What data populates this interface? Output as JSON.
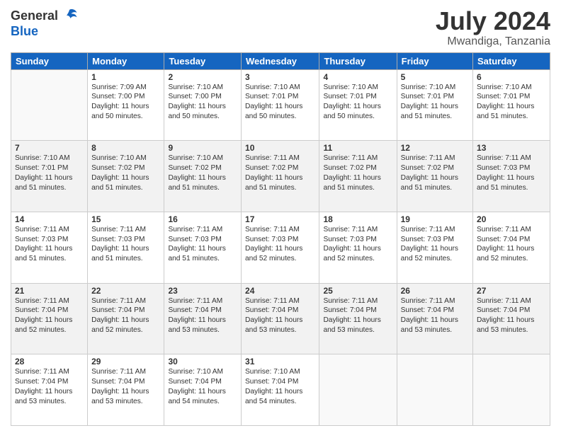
{
  "header": {
    "logo_general": "General",
    "logo_blue": "Blue",
    "month": "July 2024",
    "location": "Mwandiga, Tanzania"
  },
  "days_of_week": [
    "Sunday",
    "Monday",
    "Tuesday",
    "Wednesday",
    "Thursday",
    "Friday",
    "Saturday"
  ],
  "weeks": [
    [
      {
        "day": "",
        "info": ""
      },
      {
        "day": "1",
        "info": "Sunrise: 7:09 AM\nSunset: 7:00 PM\nDaylight: 11 hours\nand 50 minutes."
      },
      {
        "day": "2",
        "info": "Sunrise: 7:10 AM\nSunset: 7:00 PM\nDaylight: 11 hours\nand 50 minutes."
      },
      {
        "day": "3",
        "info": "Sunrise: 7:10 AM\nSunset: 7:01 PM\nDaylight: 11 hours\nand 50 minutes."
      },
      {
        "day": "4",
        "info": "Sunrise: 7:10 AM\nSunset: 7:01 PM\nDaylight: 11 hours\nand 50 minutes."
      },
      {
        "day": "5",
        "info": "Sunrise: 7:10 AM\nSunset: 7:01 PM\nDaylight: 11 hours\nand 51 minutes."
      },
      {
        "day": "6",
        "info": "Sunrise: 7:10 AM\nSunset: 7:01 PM\nDaylight: 11 hours\nand 51 minutes."
      }
    ],
    [
      {
        "day": "7",
        "info": "Sunrise: 7:10 AM\nSunset: 7:01 PM\nDaylight: 11 hours\nand 51 minutes."
      },
      {
        "day": "8",
        "info": "Sunrise: 7:10 AM\nSunset: 7:02 PM\nDaylight: 11 hours\nand 51 minutes."
      },
      {
        "day": "9",
        "info": "Sunrise: 7:10 AM\nSunset: 7:02 PM\nDaylight: 11 hours\nand 51 minutes."
      },
      {
        "day": "10",
        "info": "Sunrise: 7:11 AM\nSunset: 7:02 PM\nDaylight: 11 hours\nand 51 minutes."
      },
      {
        "day": "11",
        "info": "Sunrise: 7:11 AM\nSunset: 7:02 PM\nDaylight: 11 hours\nand 51 minutes."
      },
      {
        "day": "12",
        "info": "Sunrise: 7:11 AM\nSunset: 7:02 PM\nDaylight: 11 hours\nand 51 minutes."
      },
      {
        "day": "13",
        "info": "Sunrise: 7:11 AM\nSunset: 7:03 PM\nDaylight: 11 hours\nand 51 minutes."
      }
    ],
    [
      {
        "day": "14",
        "info": "Sunrise: 7:11 AM\nSunset: 7:03 PM\nDaylight: 11 hours\nand 51 minutes."
      },
      {
        "day": "15",
        "info": "Sunrise: 7:11 AM\nSunset: 7:03 PM\nDaylight: 11 hours\nand 51 minutes."
      },
      {
        "day": "16",
        "info": "Sunrise: 7:11 AM\nSunset: 7:03 PM\nDaylight: 11 hours\nand 51 minutes."
      },
      {
        "day": "17",
        "info": "Sunrise: 7:11 AM\nSunset: 7:03 PM\nDaylight: 11 hours\nand 52 minutes."
      },
      {
        "day": "18",
        "info": "Sunrise: 7:11 AM\nSunset: 7:03 PM\nDaylight: 11 hours\nand 52 minutes."
      },
      {
        "day": "19",
        "info": "Sunrise: 7:11 AM\nSunset: 7:03 PM\nDaylight: 11 hours\nand 52 minutes."
      },
      {
        "day": "20",
        "info": "Sunrise: 7:11 AM\nSunset: 7:04 PM\nDaylight: 11 hours\nand 52 minutes."
      }
    ],
    [
      {
        "day": "21",
        "info": "Sunrise: 7:11 AM\nSunset: 7:04 PM\nDaylight: 11 hours\nand 52 minutes."
      },
      {
        "day": "22",
        "info": "Sunrise: 7:11 AM\nSunset: 7:04 PM\nDaylight: 11 hours\nand 52 minutes."
      },
      {
        "day": "23",
        "info": "Sunrise: 7:11 AM\nSunset: 7:04 PM\nDaylight: 11 hours\nand 53 minutes."
      },
      {
        "day": "24",
        "info": "Sunrise: 7:11 AM\nSunset: 7:04 PM\nDaylight: 11 hours\nand 53 minutes."
      },
      {
        "day": "25",
        "info": "Sunrise: 7:11 AM\nSunset: 7:04 PM\nDaylight: 11 hours\nand 53 minutes."
      },
      {
        "day": "26",
        "info": "Sunrise: 7:11 AM\nSunset: 7:04 PM\nDaylight: 11 hours\nand 53 minutes."
      },
      {
        "day": "27",
        "info": "Sunrise: 7:11 AM\nSunset: 7:04 PM\nDaylight: 11 hours\nand 53 minutes."
      }
    ],
    [
      {
        "day": "28",
        "info": "Sunrise: 7:11 AM\nSunset: 7:04 PM\nDaylight: 11 hours\nand 53 minutes."
      },
      {
        "day": "29",
        "info": "Sunrise: 7:11 AM\nSunset: 7:04 PM\nDaylight: 11 hours\nand 53 minutes."
      },
      {
        "day": "30",
        "info": "Sunrise: 7:10 AM\nSunset: 7:04 PM\nDaylight: 11 hours\nand 54 minutes."
      },
      {
        "day": "31",
        "info": "Sunrise: 7:10 AM\nSunset: 7:04 PM\nDaylight: 11 hours\nand 54 minutes."
      },
      {
        "day": "",
        "info": ""
      },
      {
        "day": "",
        "info": ""
      },
      {
        "day": "",
        "info": ""
      }
    ]
  ]
}
